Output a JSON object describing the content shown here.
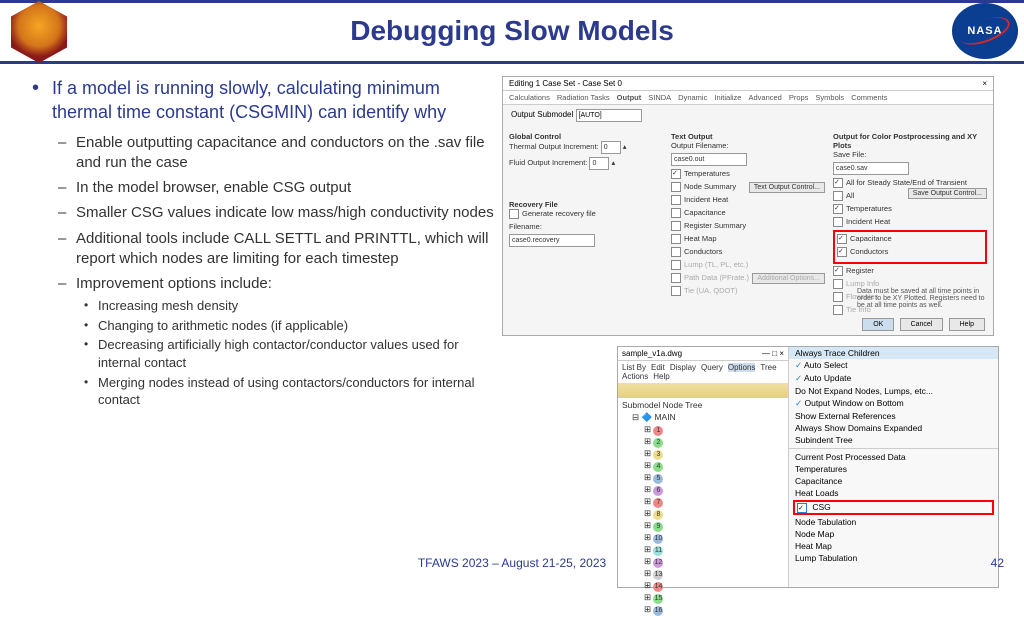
{
  "title": "Debugging Slow Models",
  "logo_right_text": "NASA",
  "main_bullet": "If a model is running slowly, calculating minimum thermal time constant (CSGMIN) can identify why",
  "sub": [
    "Enable outputting capacitance and conductors on the .sav file and run the case",
    "In the model browser, enable CSG output",
    "Smaller CSG values indicate low mass/high conductivity nodes",
    "Additional tools include CALL SETTL and PRINTTL, which will report which nodes are limiting for each timestep",
    "Improvement options include:"
  ],
  "sub2": [
    "Increasing mesh density",
    "Changing to arithmetic nodes (if applicable)",
    "Decreasing artificially high contactor/conductor values used for internal contact",
    "Merging nodes instead of using contactors/conductors for internal contact"
  ],
  "footer": "TFAWS 2023 – August 21-25, 2023",
  "page": "42",
  "d1": {
    "title": "Editing 1 Case Set - Case Set 0",
    "close": "×",
    "tabs": [
      "Calculations",
      "Radiation Tasks",
      "Output",
      "SINDA",
      "Dynamic",
      "Initialize",
      "Advanced",
      "Props",
      "Symbols",
      "Comments"
    ],
    "output_submodel_lbl": "Output Submodel",
    "output_submodel_val": "[AUTO]",
    "global_lbl": "Global Control",
    "thermal_inc_lbl": "Thermal Output Increment:",
    "thermal_inc_val": "0",
    "fluid_inc_lbl": "Fluid Output Increment:",
    "fluid_inc_val": "0",
    "text_out_lbl": "Text Output",
    "out_filename_lbl": "Output Filename:",
    "out_filename_val": "case0.out",
    "opts1": [
      "Temperatures",
      "Node Summary",
      "Incident Heat",
      "Capacitance",
      "Register Summary",
      "Heat Map",
      "Conductors",
      "Lump (TL, PL, etc.)",
      "Path Data (PFrate.)",
      "Tie (UA, QDOT)"
    ],
    "btn_text_output": "Text Output Control...",
    "btn_additional": "Additional Options...",
    "color_lbl": "Output for Color Postprocessing and XY Plots",
    "save_file_lbl": "Save File:",
    "save_file_val": "case0.sav",
    "steady_lbl": "All for Steady State/End of Transient",
    "opts2": [
      "All",
      "Temperatures",
      "Incident Heat"
    ],
    "red1": "Capacitance",
    "red2": "Conductors",
    "opts3": [
      "Register",
      "Lump Info",
      "Flowrates",
      "Tie Info"
    ],
    "btn_save_output": "Save Output Control...",
    "note": "Data must be saved at all time points in order to be XY Plotted. Registers need to be at all time points as well.",
    "recovery_lbl": "Recovery File",
    "gen_recovery": "Generate recovery file",
    "filename_lbl": "Filename:",
    "filename_val": "case0.recovery",
    "ok": "OK",
    "cancel": "Cancel",
    "help": "Help"
  },
  "d2": {
    "win_title": "sample_v1a.dwg",
    "win_ctrls": "— □ ×",
    "menu": [
      "List By",
      "Edit",
      "Display",
      "Query",
      "Options",
      "Tree Actions",
      "Help"
    ],
    "right_hdr": "Always Trace Children",
    "tree_root": "Submodel Node Tree",
    "tree_main": "MAIN",
    "nodes": [
      "1",
      "2",
      "3",
      "4",
      "5",
      "6",
      "7",
      "8",
      "9",
      "10",
      "11",
      "12",
      "13",
      "14",
      "15",
      "16"
    ],
    "opts": [
      {
        "t": "Auto Select",
        "c": true
      },
      {
        "t": "Auto Update",
        "c": true
      },
      {
        "t": "Do Not Expand Nodes, Lumps, etc...",
        "c": false
      },
      {
        "t": "Output Window on Bottom",
        "c": true
      },
      {
        "t": "Show External References",
        "c": false
      },
      {
        "t": "Always Show Domains Expanded",
        "c": false
      },
      {
        "t": "Subindent Tree",
        "c": false
      },
      {
        "t": "Current Post Processed Data",
        "c": false
      },
      {
        "t": "Temperatures",
        "c": false
      },
      {
        "t": "Capacitance",
        "c": false
      },
      {
        "t": "Heat Loads",
        "c": false
      }
    ],
    "csg": "CSG",
    "after": [
      "Node Tabulation",
      "Node Map",
      "Heat Map",
      "Lump Tabulation"
    ]
  }
}
